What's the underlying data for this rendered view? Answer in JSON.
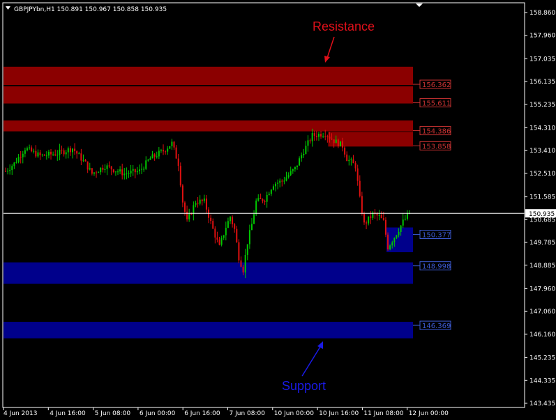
{
  "header": {
    "symbol_info": "GBPJPYbn,H1  150.891 150.967 150.858 150.935"
  },
  "annotations": {
    "resistance": "Resistance",
    "support": "Support"
  },
  "colors": {
    "background": "#000000",
    "axis": "#ffffff",
    "bull": "#00c800",
    "bear": "#e01010",
    "resistance_zone": "#8b0000",
    "support_zone": "#00008b",
    "resistance_text": "#e0101a",
    "support_text": "#1a1ae6"
  },
  "chart_data": {
    "type": "candlestick",
    "symbol": "GBPJPYbn",
    "timeframe": "H1",
    "ohlc_current": {
      "open": 150.891,
      "high": 150.967,
      "low": 150.858,
      "close": 150.935
    },
    "current_price_label": "150.935",
    "ylim": [
      143.4,
      159.0
    ],
    "y_ticks": [
      "158.860",
      "157.960",
      "157.035",
      "156.135",
      "155.235",
      "154.310",
      "153.410",
      "152.510",
      "151.585",
      "150.685",
      "149.785",
      "148.885",
      "147.960",
      "147.060",
      "146.160",
      "145.235",
      "144.335",
      "143.435"
    ],
    "x_ticks": [
      "4 Jun 2013",
      "4 Jun 16:00",
      "5 Jun 08:00",
      "6 Jun 00:00",
      "6 Jun 16:00",
      "7 Jun 08:00",
      "10 Jun 00:00",
      "10 Jun 16:00",
      "11 Jun 08:00",
      "12 Jun 00:00"
    ],
    "resistance_zones": [
      {
        "label": "156.362",
        "top": 156.72,
        "bottom": 156.0
      },
      {
        "label": "155.611",
        "top": 155.95,
        "bottom": 155.27
      },
      {
        "label": "154.386",
        "top": 154.6,
        "bottom": 154.17
      },
      {
        "label": "153.858",
        "top": 154.15,
        "bottom": 153.57,
        "start_index": 150
      }
    ],
    "support_zones": [
      {
        "label": "150.377",
        "top": 150.377,
        "bottom": 149.4,
        "start_index": 177
      },
      {
        "label": "148.998",
        "top": 148.998,
        "bottom": 148.15
      },
      {
        "label": "146.369",
        "top": 146.65,
        "bottom": 146.0
      }
    ],
    "key_points": [
      [
        0,
        152.6
      ],
      [
        4,
        152.9
      ],
      [
        9,
        153.5
      ],
      [
        16,
        153.2
      ],
      [
        24,
        153.3
      ],
      [
        31,
        153.5
      ],
      [
        37,
        152.9
      ],
      [
        40,
        152.5
      ],
      [
        46,
        152.8
      ],
      [
        55,
        152.5
      ],
      [
        62,
        152.6
      ],
      [
        67,
        153.1
      ],
      [
        73,
        153.4
      ],
      [
        77,
        153.7
      ],
      [
        80,
        152.9
      ],
      [
        82,
        151.4
      ],
      [
        84,
        150.6
      ],
      [
        88,
        151.4
      ],
      [
        92,
        151.4
      ],
      [
        96,
        150.3
      ],
      [
        99,
        149.6
      ],
      [
        102,
        150.4
      ],
      [
        104,
        150.8
      ],
      [
        106,
        150.3
      ],
      [
        108,
        149.2
      ],
      [
        110,
        148.7
      ],
      [
        112,
        149.8
      ],
      [
        114,
        150.5
      ],
      [
        116,
        151.4
      ],
      [
        120,
        151.5
      ],
      [
        124,
        152.1
      ],
      [
        128,
        152.2
      ],
      [
        134,
        152.7
      ],
      [
        138,
        153.4
      ],
      [
        142,
        154.0
      ],
      [
        148,
        154.1
      ],
      [
        152,
        153.8
      ],
      [
        156,
        153.6
      ],
      [
        158,
        153.1
      ],
      [
        162,
        152.8
      ],
      [
        164,
        151.5
      ],
      [
        166,
        150.5
      ],
      [
        170,
        150.9
      ],
      [
        173,
        150.8
      ],
      [
        175,
        150.6
      ],
      [
        177,
        149.6
      ],
      [
        180,
        150.0
      ],
      [
        184,
        150.6
      ],
      [
        187,
        150.935
      ]
    ]
  }
}
